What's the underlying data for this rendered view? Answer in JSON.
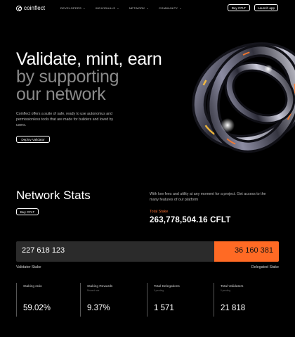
{
  "header": {
    "logo_text": "coinflect",
    "nav": [
      {
        "label": "DEVELOPERS"
      },
      {
        "label": "INDIVIDUALS"
      },
      {
        "label": "NETWORK"
      },
      {
        "label": "COMMUNITY"
      }
    ],
    "buy_label": "Buy CFLT",
    "launch_label": "Launch app"
  },
  "hero": {
    "title_line1": "Validate, mint, earn",
    "title_line2": "by supporting",
    "title_line3": "our network",
    "description": "Coinflect offers a suite of safe, ready to use autonomus and permissionless tools that are made for builders and loved by users.",
    "cta_label": "Deploy Validator"
  },
  "stats": {
    "title": "Network Stats",
    "buy_label": "Buy CFLT",
    "description": "With low fees and utility at any moment  for a project. Get access to the many features of our platform",
    "total_stake_label": "Total Stake",
    "total_stake_value": "263,778,504.16 CFLT",
    "validator_stake": "227 618 123",
    "delegated_stake": "36 160 381",
    "delegated_fraction": 0.2462,
    "validator_label": "Validator Stake",
    "delegated_label": "Delegated Stake",
    "accent_color": "#ff6a24",
    "cards": [
      {
        "label": "Staking ratio",
        "sub": "",
        "value": "59.02%"
      },
      {
        "label": "Staking Rewards",
        "sub": "Reward rate",
        "value": "9.37%"
      },
      {
        "label": "Total Delegations",
        "sub": "0 pending",
        "value": "1 571"
      },
      {
        "label": "Total Validators",
        "sub": "0 pending",
        "value": "21 818"
      }
    ]
  }
}
